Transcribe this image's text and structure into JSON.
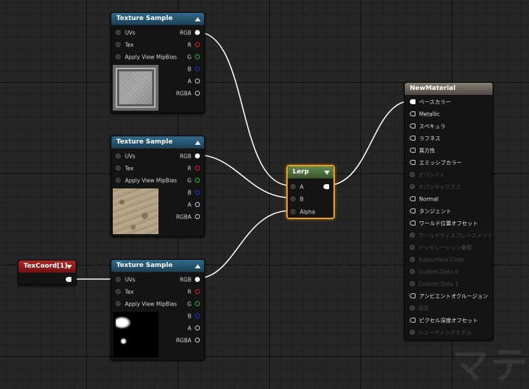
{
  "texture_nodes": [
    {
      "title": "Texture Sample",
      "inputs": [
        "UVs",
        "Tex",
        "Apply View MipBias"
      ],
      "outputs": [
        "RGB",
        "R",
        "G",
        "B",
        "A",
        "RGBA"
      ]
    },
    {
      "title": "Texture Sample",
      "inputs": [
        "UVs",
        "Tex",
        "Apply View MipBias"
      ],
      "outputs": [
        "RGB",
        "R",
        "G",
        "B",
        "A",
        "RGBA"
      ]
    },
    {
      "title": "Texture Sample",
      "inputs": [
        "UVs",
        "Tex",
        "Apply View MipBias"
      ],
      "outputs": [
        "RGB",
        "R",
        "G",
        "B",
        "A",
        "RGBA"
      ]
    }
  ],
  "texcoord_node": {
    "title": "TexCoord[1]"
  },
  "lerp_node": {
    "title": "Lerp",
    "inputs": [
      "A",
      "B",
      "Alpha"
    ]
  },
  "material_node": {
    "title": "NewMaterial",
    "inputs": [
      {
        "label": "ベースカラー",
        "enabled": true,
        "connected": true
      },
      {
        "label": "Metallic",
        "enabled": true
      },
      {
        "label": "スペキュラ",
        "enabled": true
      },
      {
        "label": "ラフネス",
        "enabled": true
      },
      {
        "label": "異方性",
        "enabled": true
      },
      {
        "label": "エミッシブカラー",
        "enabled": true
      },
      {
        "label": "オパシティ",
        "enabled": false
      },
      {
        "label": "オパシティマスク",
        "enabled": false
      },
      {
        "label": "Normal",
        "enabled": true
      },
      {
        "label": "タンジェント",
        "enabled": true
      },
      {
        "label": "ワールド位置オフセット",
        "enabled": true
      },
      {
        "label": "ワールドディスプレースメント",
        "enabled": false
      },
      {
        "label": "テッセレーション乗数",
        "enabled": false
      },
      {
        "label": "Subsurface Color",
        "enabled": false
      },
      {
        "label": "Custom Data 0",
        "enabled": false
      },
      {
        "label": "Custom Data 1",
        "enabled": false
      },
      {
        "label": "アンビエントオクルージョン",
        "enabled": true
      },
      {
        "label": "屈折",
        "enabled": false
      },
      {
        "label": "ピクセル深度オフセット",
        "enabled": true
      },
      {
        "label": "シェーディングモデル",
        "enabled": false
      }
    ]
  },
  "colors": {
    "pin_r": "#e02020",
    "pin_g": "#20c020",
    "pin_b": "#2030e0",
    "lerp_selected_border": "#f0a01e",
    "wire": "#ffffff"
  },
  "watermark": "マテ"
}
